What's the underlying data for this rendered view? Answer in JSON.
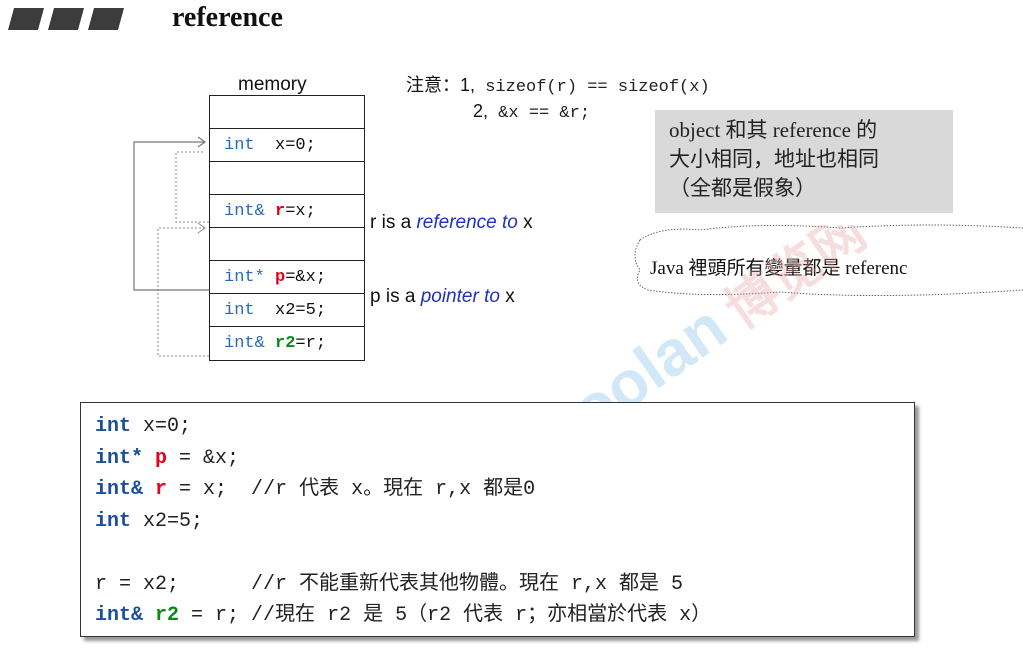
{
  "header": {
    "title": "reference"
  },
  "memory": {
    "label": "memory",
    "rows": [
      {
        "type": "",
        "name": "",
        "rest": ""
      },
      {
        "type": "int",
        "name": "",
        "rest": "  x=0;"
      },
      {
        "type": "",
        "name": "",
        "rest": ""
      },
      {
        "type": "int&",
        "name": "r",
        "rest": "=x;"
      },
      {
        "type": "",
        "name": "",
        "rest": ""
      },
      {
        "type": "int*",
        "name": "p",
        "rest": "=&x;"
      },
      {
        "type": "int",
        "name": "",
        "rest": "  x2=5;"
      },
      {
        "type": "int&",
        "name": "r2",
        "rest": "=r;"
      }
    ],
    "ref_note_prefix": "r is a ",
    "ref_note_em": "reference to",
    "ref_note_suffix": " x",
    "ptr_note_prefix": "p is a ",
    "ptr_note_em": "pointer to",
    "ptr_note_suffix": " x"
  },
  "note": {
    "lead": "注意：",
    "n1": "1,",
    "c1": " sizeof(r) == sizeof(x)",
    "n2": "2,",
    "c2": " &x == &r;"
  },
  "graybox": {
    "line1": "object 和其 reference 的",
    "line2": "大小相同，地址也相同",
    "line3": "（全都是假象）"
  },
  "cloud": {
    "text": "Java 裡頭所有變量都是 referenc"
  },
  "code": {
    "l1_kw": "int",
    "l1_rest": " x=0;",
    "l2_kw": "int*",
    "l2_var": "p",
    "l2_rest": " = &x;",
    "l3_kw": "int&",
    "l3_var": "r",
    "l3_rest": " = x;  //r 代表 x。現在 r,x 都是0",
    "l4_kw": "int",
    "l4_rest": " x2=5;",
    "l6": "r = x2;      //r 不能重新代表其他物體。現在 r,x 都是 5",
    "l7_kw": "int&",
    "l7_var": "r2",
    "l7_rest": " = r; //現在 r2 是 5（r2 代表 r；亦相當於代表 x）"
  },
  "watermark": {
    "text": "Boolan 博览网"
  },
  "colors": {
    "red": "#e8001c",
    "green": "#0a8a1a",
    "keyword_blue": "#1a4fa0",
    "italic_blue": "#2030c0"
  }
}
